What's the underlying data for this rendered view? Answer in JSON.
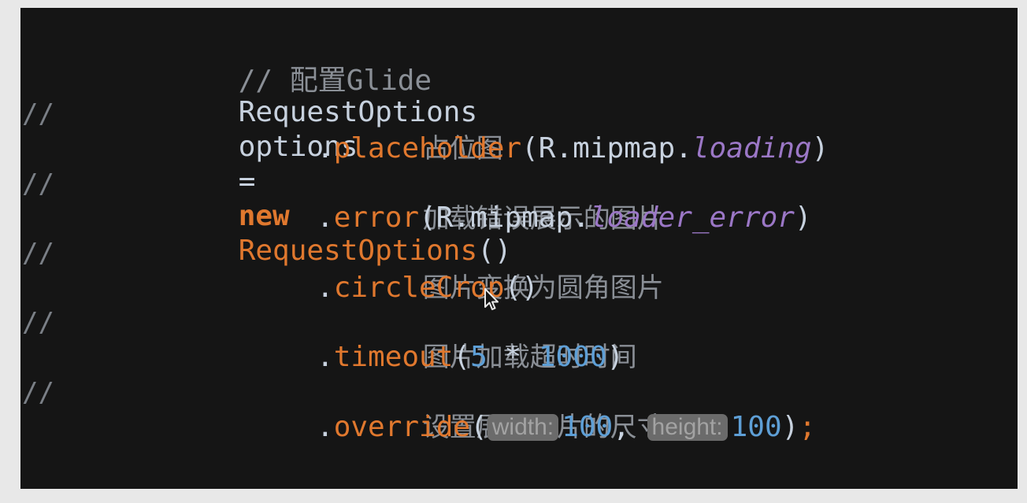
{
  "editor": {
    "comment_marker": "//",
    "lines": [
      {
        "comment": "// 配置Glide"
      },
      {
        "type": "RequestOptions",
        "var": "options",
        "eq": "=",
        "keyword": "new",
        "ctor": "RequestOptions",
        "parens": "()"
      },
      {
        "cn": "占位图"
      },
      {
        "dot": ".",
        "method": "placeholder",
        "open": "(",
        "prefix": "R.mipmap.",
        "field": "loading",
        "close": ")"
      },
      {
        "cn": "加载错误展示的图片"
      },
      {
        "dot": ".",
        "method": "error",
        "open": "(",
        "prefix": "R.mipmap.",
        "field": "loader_error",
        "close": ")"
      },
      {
        "cn": "图片变换为圆角图片"
      },
      {
        "dot": ".",
        "method": "circleCrop",
        "parens": "()"
      },
      {
        "cn": "图片加载超时时间"
      },
      {
        "dot": ".",
        "method": "timeout",
        "open": "(",
        "a": "5",
        "op": " * ",
        "b": "1000",
        "close": ")"
      },
      {
        "cn": "设置展示图片的尺寸"
      },
      {
        "dot": ".",
        "method": "override",
        "open": "(",
        "hint1": "width:",
        "v1": "100",
        "comma": ", ",
        "hint2": "height:",
        "v2": "100",
        "close": ")",
        "semi": ";"
      }
    ]
  }
}
